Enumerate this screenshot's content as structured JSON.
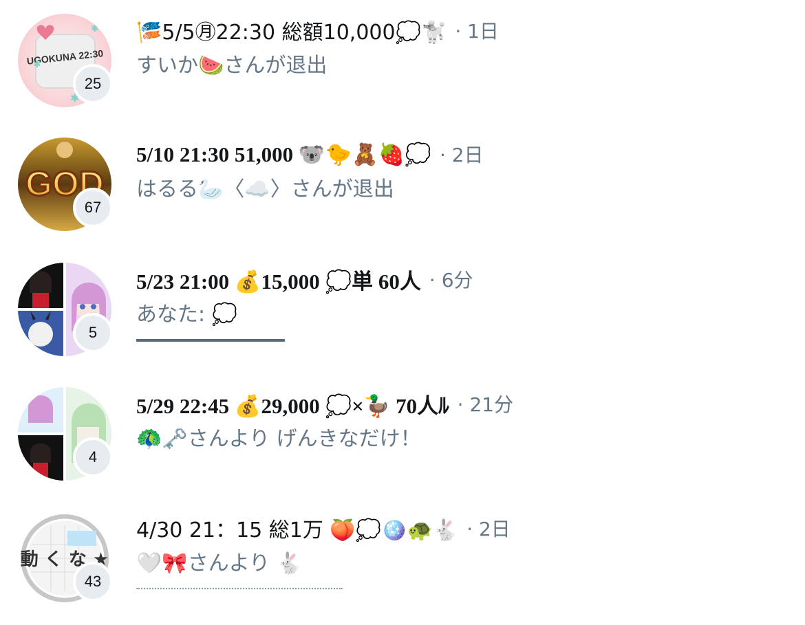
{
  "chats": [
    {
      "title": "🎏5/5㊊22:30 総額10,000💭🐩",
      "time_ago": "· 1日",
      "subtitle": "すいか🍉さんが退出",
      "member_count": "25",
      "avatar_text": "UGOKUNA 22:30"
    },
    {
      "title": "5/10  21:30 51,000 🐨🐤🧸🍓💭",
      "time_ago": "· 2日",
      "subtitle": "はるる🦢〈☁️〉さんが退出",
      "member_count": "67",
      "avatar_text": "GOD"
    },
    {
      "title": "5/23  21:00   💰15,000 💭単 60人",
      "time_ago": "· 6分",
      "subtitle": "あなた: 💭",
      "member_count": "5"
    },
    {
      "title": "5/29 22:45 💰29,000 💭×🦆 70人ﾙ",
      "time_ago": "· 21分",
      "subtitle": "🦚🗝️さんより げんきなだけ！",
      "member_count": "4"
    },
    {
      "title": "4/30 21：15 総1万 🍑💭🪩🐢🐇",
      "time_ago": "· 2日",
      "subtitle": "🤍🎀さんより 🐇",
      "member_count": "43",
      "avatar_text": "動 く な ★"
    }
  ]
}
